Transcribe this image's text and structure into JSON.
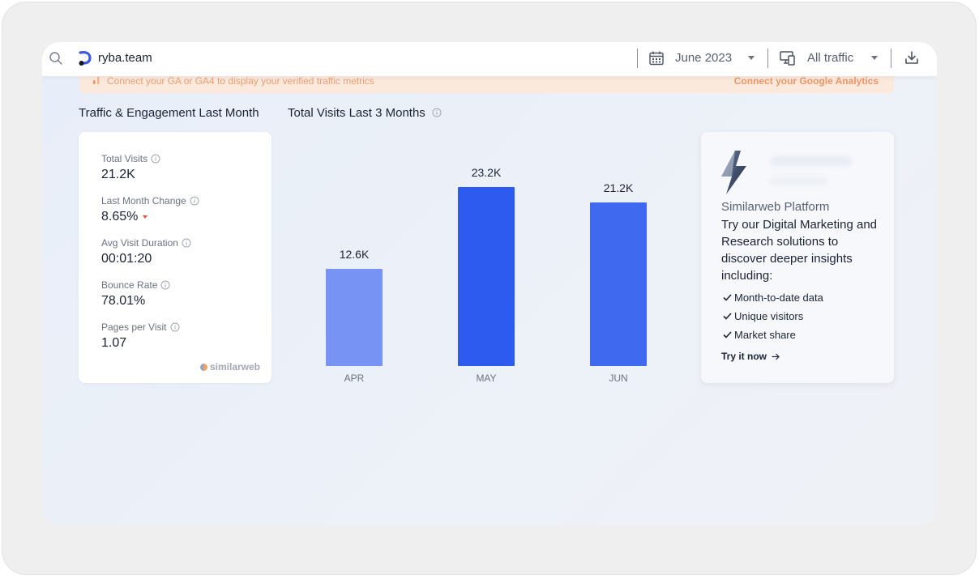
{
  "topbar": {
    "site_name": "ryba.team",
    "date_label": "June 2023",
    "traffic_label": "All traffic"
  },
  "banner": {
    "text": "Connect your GA or GA4 to display your verified traffic metrics",
    "link": "Connect your Google Analytics"
  },
  "sections": {
    "engagement_title": "Traffic & Engagement Last Month",
    "visits_title": "Total Visits Last 3 Months"
  },
  "metrics": [
    {
      "label": "Total Visits",
      "value": "21.2K"
    },
    {
      "label": "Last Month Change",
      "value": "8.65%"
    },
    {
      "label": "Avg Visit Duration",
      "value": "00:01:20"
    },
    {
      "label": "Bounce Rate",
      "value": "78.01%"
    },
    {
      "label": "Pages per Visit",
      "value": "1.07"
    }
  ],
  "brand": "similarweb",
  "chart_data": {
    "type": "bar",
    "categories": [
      "APR",
      "MAY",
      "JUN"
    ],
    "values": [
      12.6,
      23.2,
      21.2
    ],
    "value_labels": [
      "12.6K",
      "23.2K",
      "21.2K"
    ],
    "title": "Total Visits Last 3 Months",
    "colors": [
      "#7793f3",
      "#2d5bef",
      "#3f6af0"
    ],
    "ylim": [
      0,
      23.2
    ],
    "grid": false
  },
  "promo": {
    "title": "Similarweb Platform",
    "body": "Try our Digital Marketing and Research solutions to discover deeper insights including:",
    "items": [
      "Month-to-date data",
      "Unique visitors",
      "Market share"
    ],
    "cta": "Try it now"
  },
  "colors": {
    "accent": "#2d5bef",
    "banner_bg": "#fbe9dc",
    "banner_text": "#ef9667",
    "negative": "#e5533c"
  }
}
